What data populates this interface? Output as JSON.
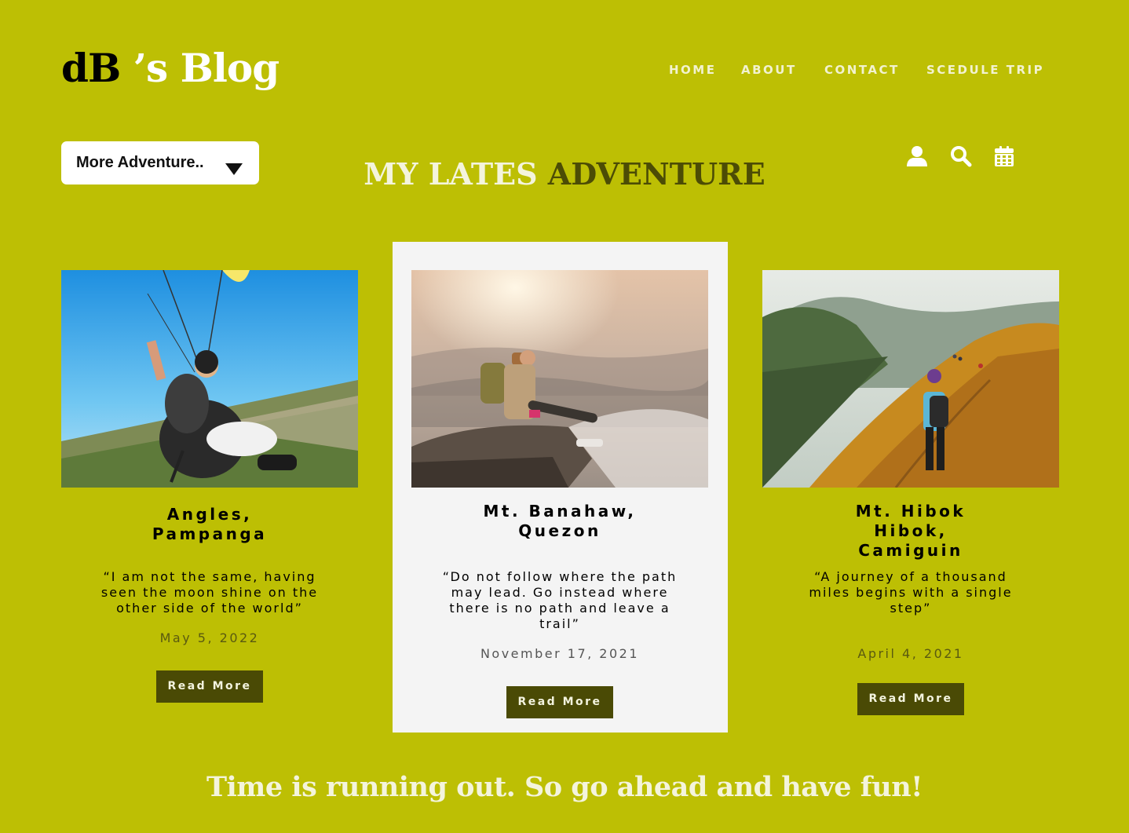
{
  "brand": {
    "logo_dark": "dB",
    "logo_light": " ’s Blog"
  },
  "nav": {
    "items": [
      {
        "label": "HOME"
      },
      {
        "label": "ABOUT"
      },
      {
        "label": "CONTACT"
      },
      {
        "label": "SCEDULE TRIP"
      }
    ]
  },
  "dropdown": {
    "label": "More Adventure.."
  },
  "heading": {
    "part1": "MY LATES",
    "part2": "ADVENTURE"
  },
  "icons": [
    "user-icon",
    "search-icon",
    "calendar-icon"
  ],
  "cards": [
    {
      "image": "paragliding-photo",
      "location": "Angles, Pampanga",
      "quote": "“I am not the same, having seen the moon shine on the other side of the world”",
      "date": "May 5, 2022",
      "button": "Read More"
    },
    {
      "image": "hiker-on-rock-photo",
      "location": "Mt. Banahaw, Quezon",
      "quote": "“Do not follow where the path may lead. Go instead where there is no path and leave a trail”",
      "date": "November 17, 2021",
      "button": "Read More"
    },
    {
      "image": "mountain-ridge-hike-photo",
      "location": "Mt. Hibok Hibok, Camiguin",
      "quote": "“A journey of a thousand miles begins with a single step”",
      "date": "April 4, 2021",
      "button": "Read More"
    }
  ],
  "footer": {
    "tagline": "Time is running out. So go ahead and have fun!"
  },
  "colors": {
    "background": "#bdbf04",
    "dark_accent": "#4a4a05",
    "featured_card": "#f4f4f4"
  }
}
